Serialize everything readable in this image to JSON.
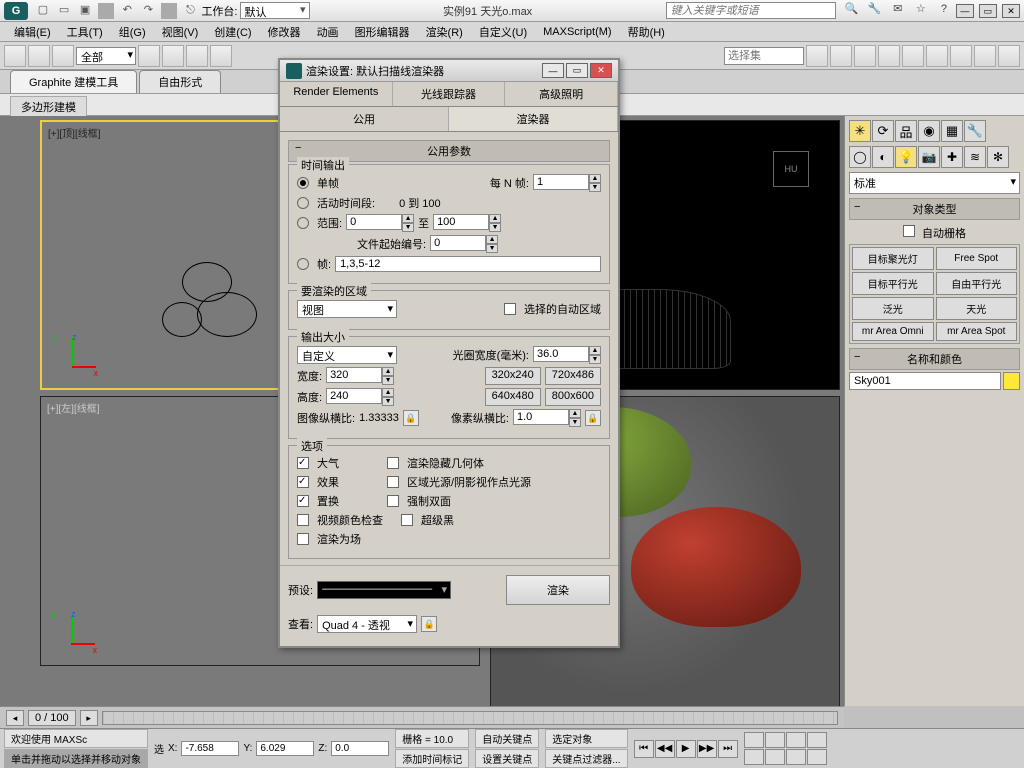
{
  "title": {
    "workspace_label": "工作台:",
    "workspace": "默认",
    "filename": "实例91  天光o.max",
    "search_placeholder": "键入关键字或短语"
  },
  "menus": {
    "edit": "编辑(E)",
    "tools": "工具(T)",
    "group": "组(G)",
    "views": "视图(V)",
    "create": "创建(C)",
    "modifiers": "修改器",
    "animation": "动画",
    "grapheditors": "图形编辑器",
    "rendering": "渲染(R)",
    "customize": "自定义(U)",
    "maxscript": "MAXScript(M)",
    "help": "帮助(H)"
  },
  "toolbar": {
    "selset_label": "选择集",
    "filter": "全部"
  },
  "ribbon": {
    "tab1": "Graphite 建模工具",
    "tab2": "自由形式",
    "sub1": "多边形建模"
  },
  "viewports": {
    "tl": "[+][顶][线框]",
    "tr": "",
    "bl": "[+][左][线框]",
    "br": ""
  },
  "dialog": {
    "title": "渲染设置: 默认扫描线渲染器",
    "tabs_top": {
      "t1": "Render Elements",
      "t2": "光线跟踪器",
      "t3": "高级照明"
    },
    "tabs2": {
      "t1": "公用",
      "t2": "渲染器"
    },
    "roll_common": "公用参数",
    "timeoutput": {
      "label": "时间输出",
      "single": "单帧",
      "nth_label": "每 N 帧:",
      "nth_value": "1",
      "active": "活动时间段:",
      "active_range": "0 到 100",
      "range": "范围:",
      "range_from": "0",
      "range_to_label": "至",
      "range_to": "100",
      "filenum_label": "文件起始编号:",
      "filenum": "0",
      "frames": "帧:",
      "frames_value": "1,3,5-12"
    },
    "area": {
      "label": "要渲染的区域",
      "mode": "视图",
      "autoregion": "选择的自动区域"
    },
    "size": {
      "label": "输出大小",
      "mode": "自定义",
      "aperture": "光圈宽度(毫米):",
      "aperture_value": "36.0",
      "width": "宽度:",
      "width_v": "320",
      "height": "高度:",
      "height_v": "240",
      "p1": "320x240",
      "p2": "720x486",
      "p3": "640x480",
      "p4": "800x600",
      "imgaspect": "图像纵横比:",
      "imgaspect_v": "1.33333",
      "pixaspect": "像素纵横比:",
      "pixaspect_v": "1.0"
    },
    "options": {
      "label": "选项",
      "atmos": "大气",
      "hidden": "渲染隐藏几何体",
      "effects": "效果",
      "arealight": "区域光源/阴影视作点光源",
      "displace": "置换",
      "force2": "强制双面",
      "videocheck": "视频颜色检查",
      "superblack": "超级黑",
      "rendfields": "渲染为场"
    },
    "footer": {
      "preset": "预设:",
      "preset_value": "——————————",
      "view": "查看:",
      "view_value": "Quad 4 - 透视",
      "render_btn": "渲染"
    }
  },
  "panel": {
    "dropdown": "标准",
    "objtype": "对象类型",
    "autogrid": "自动栅格",
    "b": {
      "tspot": "目标聚光灯",
      "fspot": "Free Spot",
      "tdir": "目标平行光",
      "fdir": "自由平行光",
      "omni": "泛光",
      "sky": "天光",
      "mromni": "mr Area Omni",
      "mrspot": "mr Area Spot"
    },
    "namecolor": "名称和颜色",
    "name_value": "Sky001"
  },
  "timeline": {
    "label": "0 / 100"
  },
  "status": {
    "welcome": "欢迎使用 MAXSc",
    "prompt": "单击并拖动以选择并移动对象",
    "sel_count": "选",
    "x": "X:",
    "xv": "-7.658",
    "y": "Y:",
    "yv": "6.029",
    "z": "Z:",
    "zv": "0.0",
    "grid": "栅格 = 10.0",
    "addtimetag": "添加时间标记",
    "autokey": "自动关键点",
    "setkey": "设置关键点",
    "selobj": "选定对象",
    "keyfilter": "关键点过滤器..."
  }
}
